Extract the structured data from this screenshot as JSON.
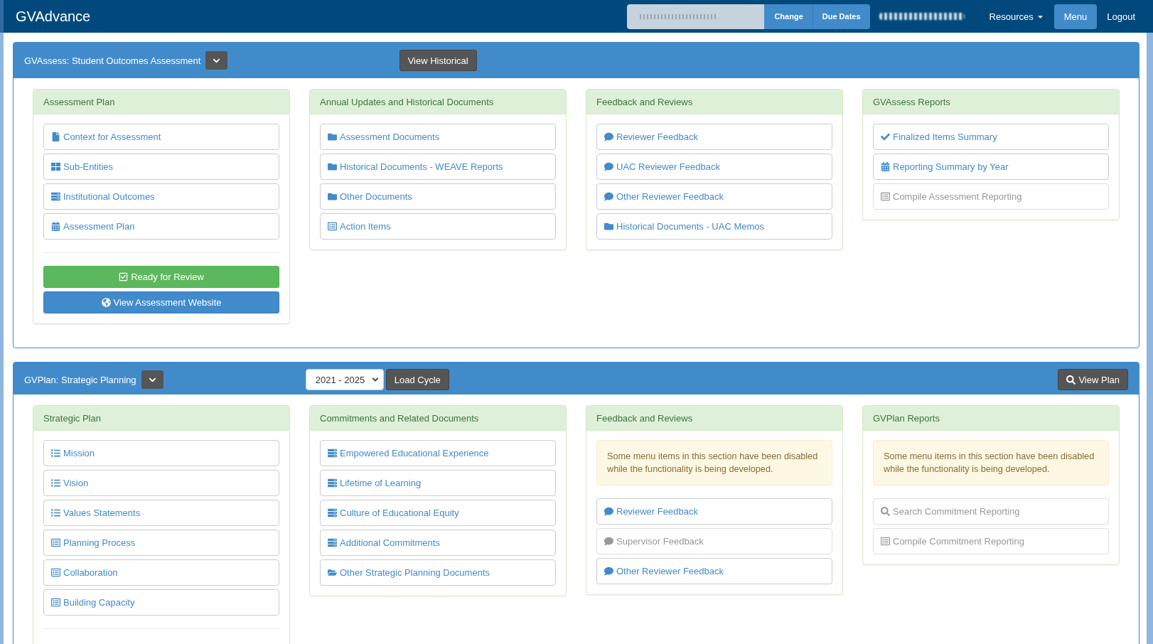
{
  "navbar": {
    "brand": "GVAdvance",
    "buttons": [
      {
        "label": "Change"
      },
      {
        "label": "Due Dates"
      }
    ],
    "links": [
      {
        "label": "Resources",
        "dropdown": true,
        "selected": false
      },
      {
        "label": "Menu",
        "dropdown": false,
        "selected": true
      },
      {
        "label": "Logout",
        "dropdown": false,
        "selected": false
      }
    ]
  },
  "panels": [
    {
      "title": "GVAssess: Student Outcomes Assessment",
      "controls": [
        {
          "kind": "button",
          "label": "View Historical"
        }
      ],
      "cards": [
        {
          "title": "Assessment Plan",
          "items": [
            {
              "label": "Context for Assessment",
              "kind": "document",
              "disabled": false
            },
            {
              "label": "Sub-Entities",
              "kind": "grid",
              "disabled": false
            },
            {
              "label": "Institutional Outcomes",
              "kind": "tasks",
              "disabled": false
            },
            {
              "label": "Assessment Plan",
              "kind": "calendar",
              "disabled": false
            }
          ],
          "divider": true,
          "actions": [
            {
              "label": "Ready for Review",
              "kind": "success"
            },
            {
              "label": "View Assessment Website",
              "kind": "primary"
            }
          ]
        },
        {
          "title": "Annual Updates and Historical Documents",
          "items": [
            {
              "label": "Assessment Documents",
              "kind": "folder",
              "disabled": false
            },
            {
              "label": "Historical Documents - WEAVE Reports",
              "kind": "folder",
              "disabled": false
            },
            {
              "label": "Other Documents",
              "kind": "folder",
              "disabled": false
            },
            {
              "label": "Action Items",
              "kind": "listing",
              "disabled": false
            }
          ]
        },
        {
          "title": "Feedback and Reviews",
          "items": [
            {
              "label": "Reviewer Feedback",
              "kind": "comment",
              "disabled": false
            },
            {
              "label": "UAC Reviewer Feedback",
              "kind": "comment",
              "disabled": false
            },
            {
              "label": "Other Reviewer Feedback",
              "kind": "comment",
              "disabled": false
            },
            {
              "label": "Historical Documents - UAC Memos",
              "kind": "folder",
              "disabled": false
            }
          ]
        },
        {
          "title": "GVAssess Reports",
          "items": [
            {
              "label": "Finalized Items Summary",
              "kind": "check",
              "disabled": false
            },
            {
              "label": "Reporting Summary by Year",
              "kind": "calendar",
              "disabled": false
            },
            {
              "label": "Compile Assessment Reporting",
              "kind": "listing",
              "disabled": true
            }
          ]
        }
      ]
    },
    {
      "title": "GVPlan: Strategic Planning",
      "controls": [
        {
          "kind": "select",
          "value": "2021 - 2025"
        },
        {
          "kind": "button",
          "label": "Load Cycle"
        }
      ],
      "end_controls": [
        {
          "kind": "search",
          "label": "View Plan"
        }
      ],
      "cards": [
        {
          "title": "Strategic Plan",
          "items": [
            {
              "label": "Mission",
              "kind": "list",
              "disabled": false
            },
            {
              "label": "Vision",
              "kind": "list",
              "disabled": false
            },
            {
              "label": "Values Statements",
              "kind": "list",
              "disabled": false
            },
            {
              "label": "Planning Process",
              "kind": "listing",
              "disabled": false
            },
            {
              "label": "Collaboration",
              "kind": "listing",
              "disabled": false
            },
            {
              "label": "Building Capacity",
              "kind": "listing",
              "disabled": false
            }
          ],
          "divider": true
        },
        {
          "title": "Commitments and Related Documents",
          "items": [
            {
              "label": "Empowered Educational Experience",
              "kind": "tasks",
              "disabled": false
            },
            {
              "label": "Lifetime of Learning",
              "kind": "tasks",
              "disabled": false
            },
            {
              "label": "Culture of Educational Equity",
              "kind": "tasks",
              "disabled": false
            },
            {
              "label": "Additional Commitments",
              "kind": "tasks",
              "disabled": false
            },
            {
              "label": "Other Strategic Planning Documents",
              "kind": "openfolder",
              "disabled": false
            }
          ]
        },
        {
          "title": "Feedback and Reviews",
          "notice": "Some menu items in this section have been disabled while the functionality is being developed.",
          "items": [
            {
              "label": "Reviewer Feedback",
              "kind": "comment",
              "disabled": false
            },
            {
              "label": "Supervisor Feedback",
              "kind": "comment",
              "disabled": true
            },
            {
              "label": "Other Reviewer Feedback",
              "kind": "comment",
              "disabled": false
            }
          ]
        },
        {
          "title": "GVPlan Reports",
          "notice": "Some menu items in this section have been disabled while the functionality is being developed.",
          "items": [
            {
              "label": "Search Commitment Reporting",
              "kind": "search",
              "disabled": true
            },
            {
              "label": "Compile Commitment Reporting",
              "kind": "listing",
              "disabled": true
            }
          ]
        }
      ]
    }
  ]
}
